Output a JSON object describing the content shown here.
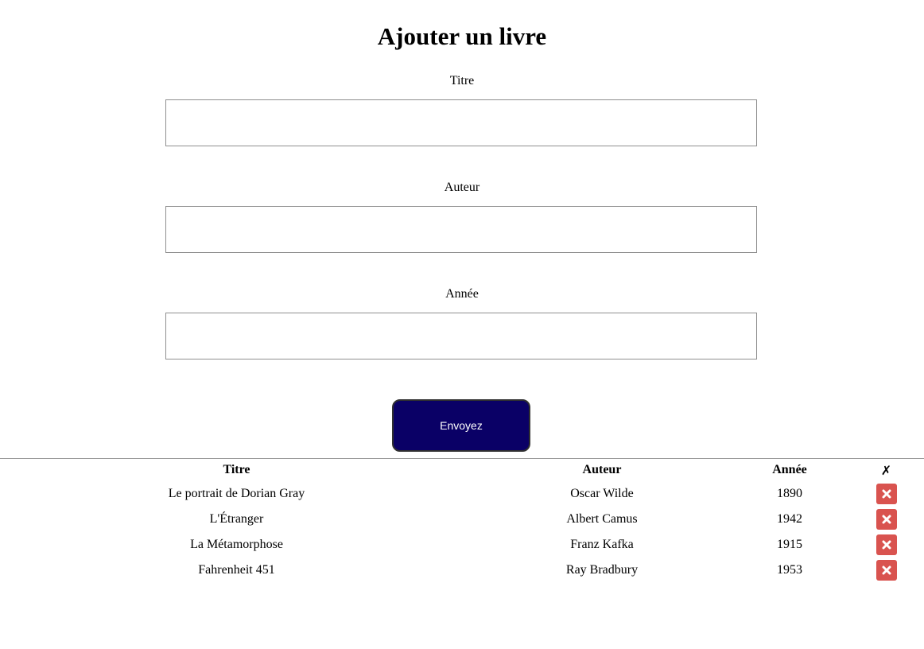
{
  "page": {
    "title": "Ajouter un livre"
  },
  "form": {
    "title_label": "Titre",
    "title_value": "",
    "author_label": "Auteur",
    "author_value": "",
    "year_label": "Année",
    "year_value": "",
    "submit_label": "Envoyez"
  },
  "table": {
    "headers": {
      "title": "Titre",
      "author": "Auteur",
      "year": "Année",
      "delete": "✗"
    },
    "rows": [
      {
        "title": "Le portrait de Dorian Gray",
        "author": "Oscar Wilde",
        "year": "1890",
        "delete_icon": "close-icon"
      },
      {
        "title": "L'Étranger",
        "author": "Albert Camus",
        "year": "1942",
        "delete_icon": "close-icon"
      },
      {
        "title": "La Métamorphose",
        "author": "Franz Kafka",
        "year": "1915",
        "delete_icon": "close-icon"
      },
      {
        "title": "Fahrenheit 451",
        "author": "Ray Bradbury",
        "year": "1953",
        "delete_icon": "close-icon"
      }
    ]
  },
  "colors": {
    "submit_button": "#0a0066",
    "delete_button": "#d9534f"
  }
}
